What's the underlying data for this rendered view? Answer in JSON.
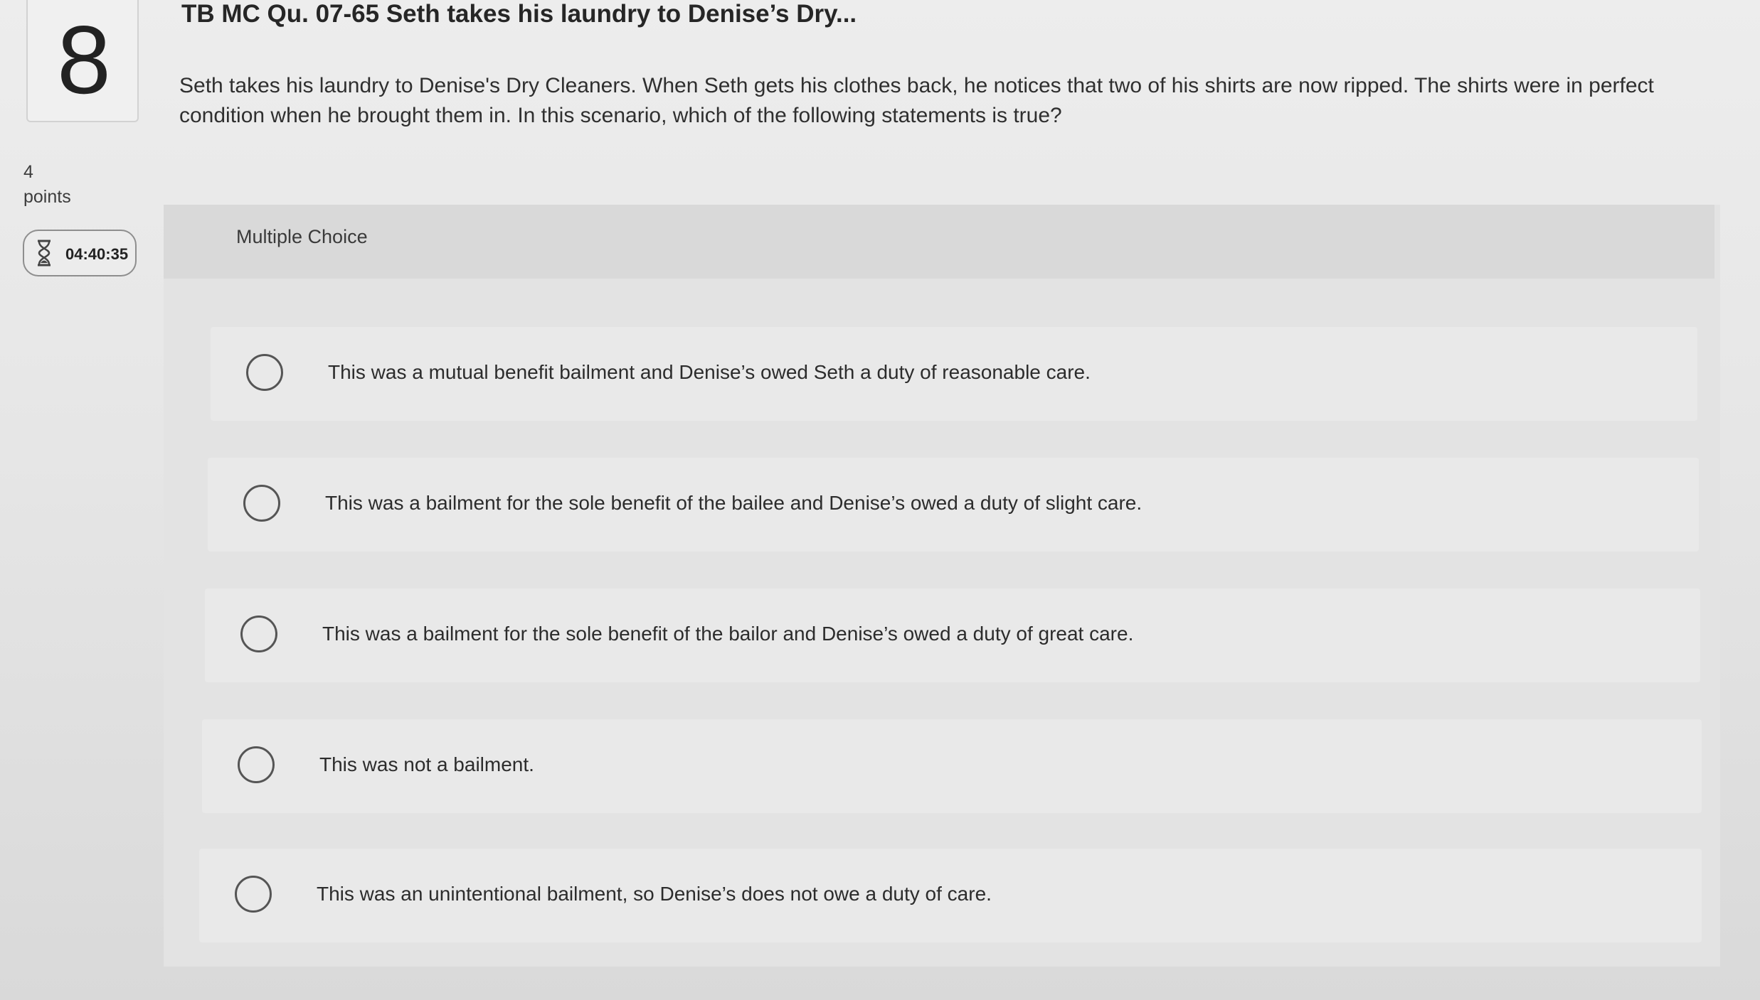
{
  "question": {
    "number": "8",
    "points_value": "4",
    "points_label": "points",
    "timer": "04:40:35",
    "title": "TB MC Qu. 07-65 Seth takes his laundry to Denise’s Dry...",
    "text": "Seth takes his laundry to Denise's Dry Cleaners. When Seth gets his clothes back, he notices that two of his shirts are now ripped. The shirts were in perfect condition when he brought them in. In this scenario, which of the following statements is true?"
  },
  "answers": {
    "type_label": "Multiple Choice",
    "options": [
      {
        "label": "This was a mutual benefit bailment and Denise’s owed Seth a duty of reasonable care."
      },
      {
        "label": "This was a bailment for the sole benefit of the bailee and Denise’s owed a duty of slight care."
      },
      {
        "label": "This was a bailment for the sole benefit of the bailor and Denise’s owed a duty of great care."
      },
      {
        "label": "This was not a bailment."
      },
      {
        "label": "This was an unintentional bailment, so Denise’s does not owe a duty of care."
      }
    ]
  },
  "icons": {
    "timer": "hourglass-icon",
    "option_radio": "radio-unchecked-icon"
  },
  "colors": {
    "background": "#e6e6e6",
    "panel": "#e3e3e3",
    "header": "#d9d9d9",
    "text": "#2b2b2b"
  }
}
